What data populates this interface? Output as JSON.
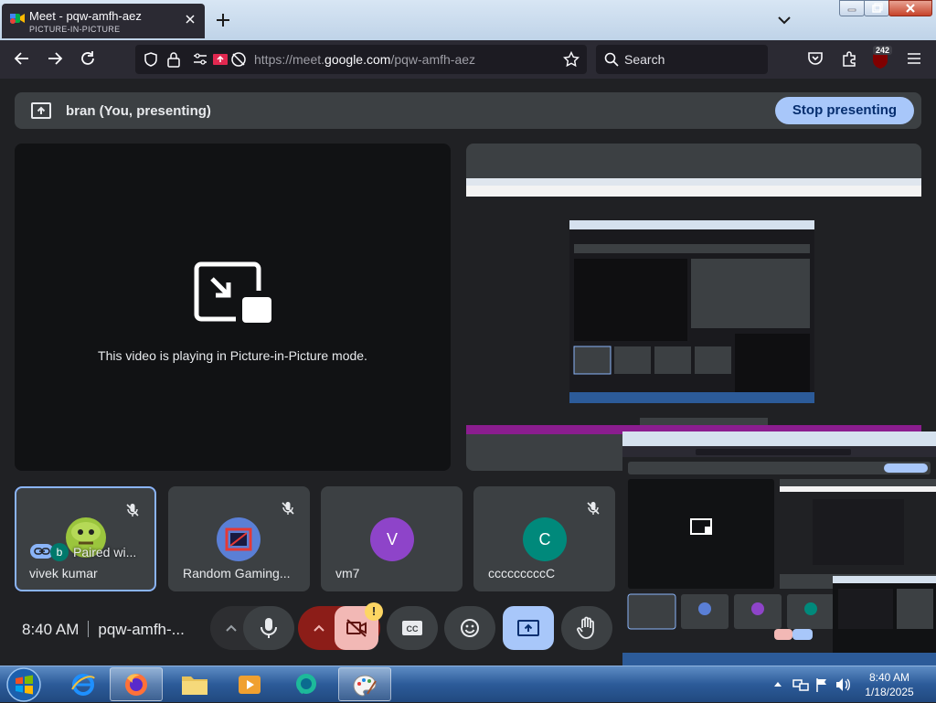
{
  "browser": {
    "tab": {
      "title": "Meet - pqw-amfh-aez",
      "subtitle": "PICTURE-IN-PICTURE"
    },
    "url_prefix": "https://meet.",
    "url_domain": "google.com",
    "url_path": "/pqw-amfh-aez",
    "search_placeholder": "Search",
    "extension_badge": "242"
  },
  "meet": {
    "banner_text": "bran (You, presenting)",
    "stop_presenting_label": "Stop presenting",
    "pip_message": "This video is playing in Picture-in-Picture mode.",
    "participants": [
      {
        "name": "vivek kumar",
        "overlay": "Paired wi...",
        "overlay_initial": "b",
        "muted": true
      },
      {
        "name": "Random Gaming...",
        "muted": true
      },
      {
        "name": "vm7",
        "initial": "V",
        "avatar_color": "#8e44c9",
        "muted": false
      },
      {
        "name": "cccccccccC",
        "initial": "C",
        "avatar_color": "#00897b",
        "muted": true
      }
    ],
    "time": "8:40 AM",
    "meeting_code": "pqw-amfh-...",
    "camera_alert": "!",
    "colors": {
      "accent": "#a8c7fa",
      "camera_off": "#f2b8b5",
      "dark_red": "#8c1d18",
      "selected_border": "#8ab4f8"
    }
  },
  "taskbar": {
    "time": "8:40 AM",
    "date": "1/18/2025"
  }
}
